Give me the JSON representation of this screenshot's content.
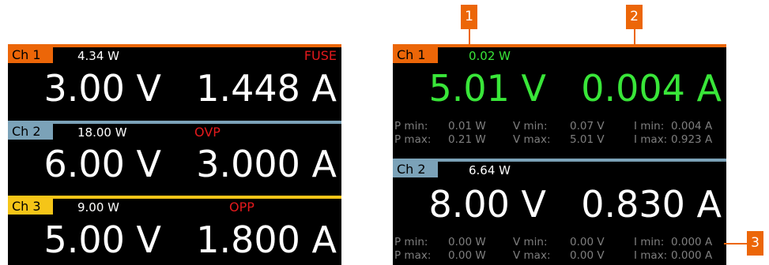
{
  "colors": {
    "ch1": "#ec6608",
    "ch2": "#7ba2b8",
    "ch3": "#f5c518",
    "measure_active": "#39e639",
    "fault": "#e3191c",
    "stat_text": "#7f7f7f"
  },
  "left": {
    "channels": [
      {
        "label": "Ch 1",
        "power": "4.34 W",
        "status": "FUSE",
        "voltage": "3.00 V",
        "current": "1.448 A"
      },
      {
        "label": "Ch 2",
        "power": "18.00 W",
        "status": "OVP",
        "voltage": "6.00 V",
        "current": "3.000 A"
      },
      {
        "label": "Ch 3",
        "power": "9.00 W",
        "status": "OPP",
        "voltage": "5.00 V",
        "current": "1.800 A"
      }
    ]
  },
  "right": {
    "channels": [
      {
        "label": "Ch 1",
        "power": "0.02 W",
        "voltage": "5.01 V",
        "current": "0.004 A",
        "stats": {
          "p_min_label": "P min:",
          "p_min": "0.01 W",
          "v_min_label": "V min:",
          "v_min": "0.07 V",
          "i_min_label": "I min:",
          "i_min": "0.004 A",
          "p_max_label": "P max:",
          "p_max": "0.21 W",
          "v_max_label": "V max:",
          "v_max": "5.01 V",
          "i_max_label": "I max:",
          "i_max": "0.923 A"
        }
      },
      {
        "label": "Ch 2",
        "power": "6.64 W",
        "voltage": "8.00 V",
        "current": "0.830 A",
        "stats": {
          "p_min_label": "P min:",
          "p_min": "0.00 W",
          "v_min_label": "V min:",
          "v_min": "0.00 V",
          "i_min_label": "I min:",
          "i_min": "0.000 A",
          "p_max_label": "P max:",
          "p_max": "0.00 W",
          "v_max_label": "V max:",
          "v_max": "0.00 V",
          "i_max_label": "I max:",
          "i_max": "0.000 A"
        }
      }
    ]
  },
  "callouts": [
    "1",
    "2",
    "3"
  ]
}
